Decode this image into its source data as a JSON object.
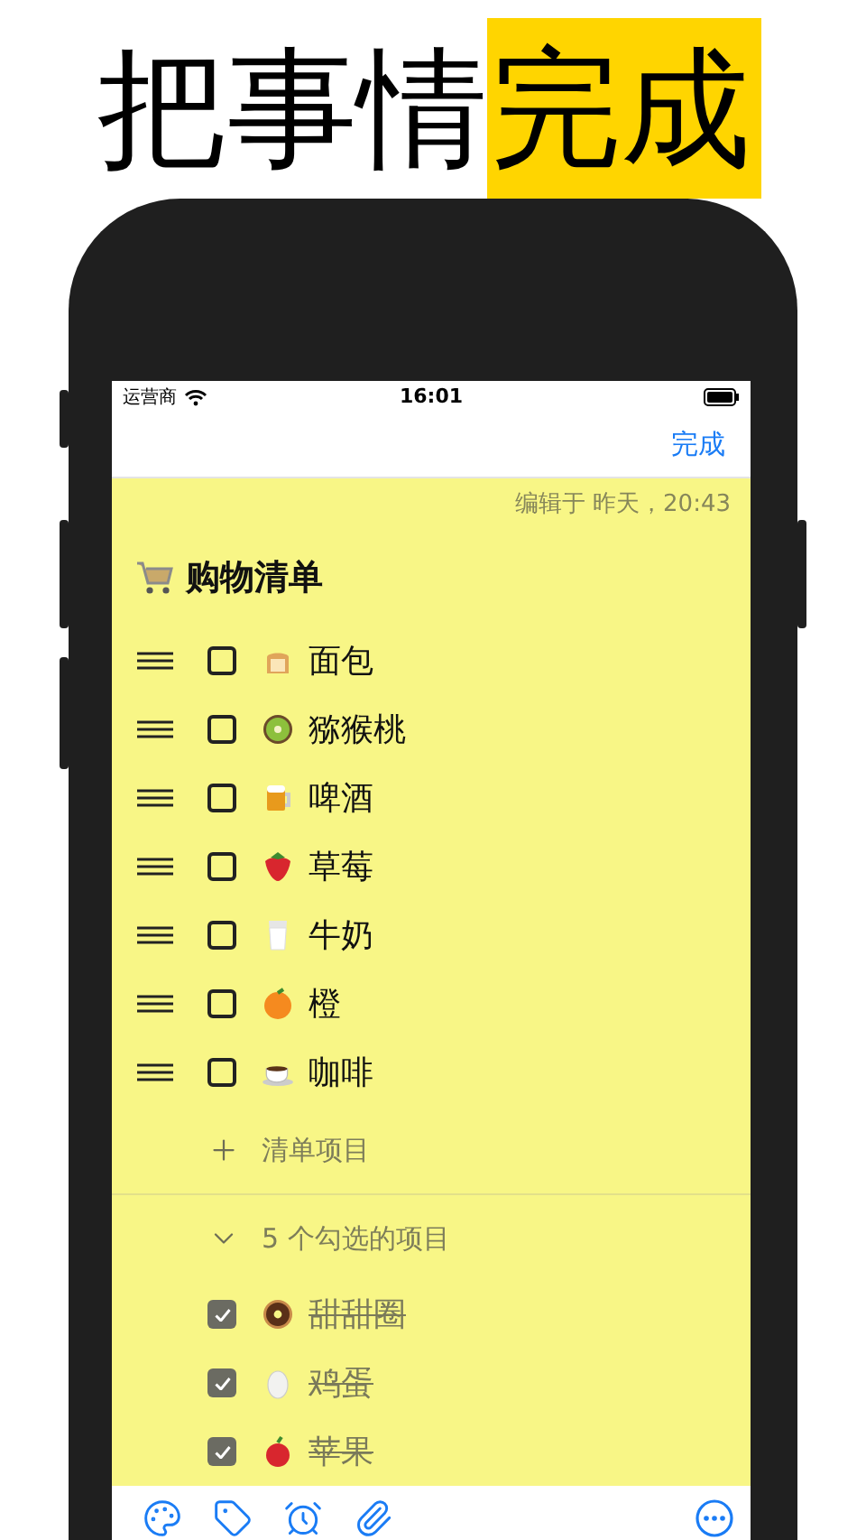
{
  "headline": {
    "text": "把事情",
    "highlight": "完成"
  },
  "status_bar": {
    "carrier": "运营商",
    "time": "16:01"
  },
  "nav": {
    "done": "完成"
  },
  "note": {
    "edited": "编辑于 昨天，20:43",
    "title": "购物清单",
    "items": [
      {
        "label": "面包",
        "checked": false
      },
      {
        "label": "猕猴桃",
        "checked": false
      },
      {
        "label": "啤酒",
        "checked": false
      },
      {
        "label": "草莓",
        "checked": false
      },
      {
        "label": "牛奶",
        "checked": false
      },
      {
        "label": "橙",
        "checked": false
      },
      {
        "label": "咖啡",
        "checked": false
      }
    ],
    "add_item": "清单项目",
    "checked_section": {
      "label": "5 个勾选的项目",
      "expanded": true,
      "items": [
        {
          "label": "甜甜圈",
          "checked": true
        },
        {
          "label": "鸡蛋",
          "checked": true
        },
        {
          "label": "苹果",
          "checked": true
        }
      ]
    }
  }
}
